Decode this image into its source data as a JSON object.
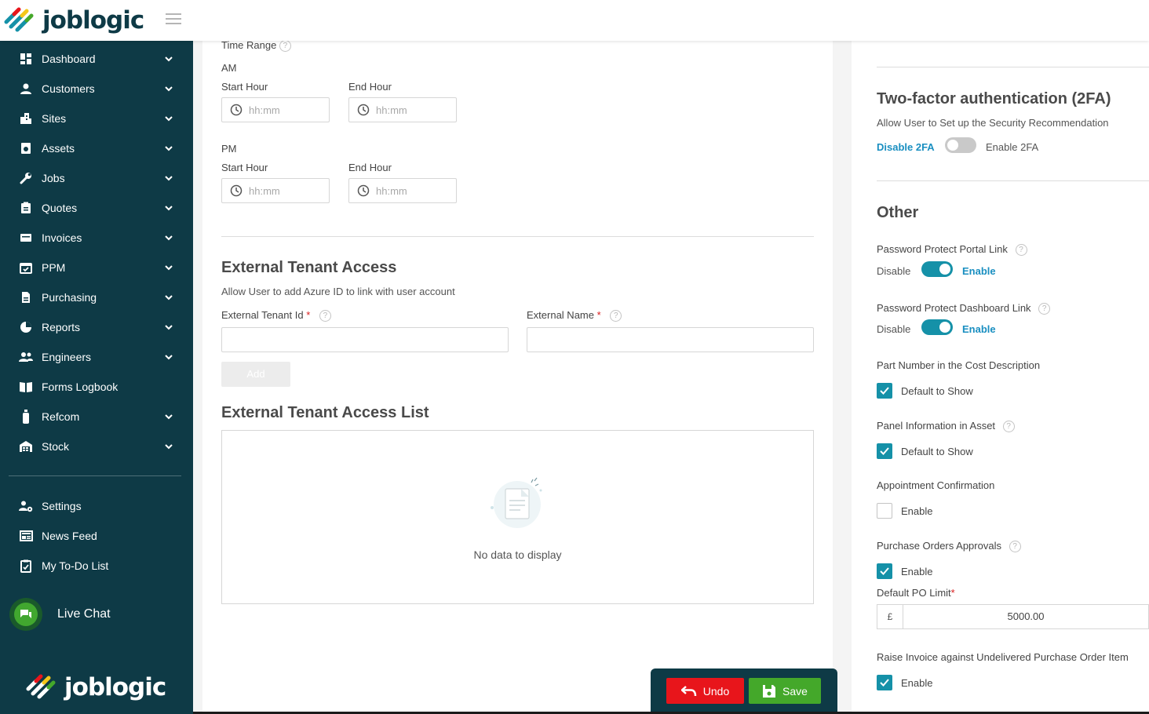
{
  "brand": {
    "name": "joblogic",
    "colors": {
      "dark": "#0e3a46",
      "accent": "#1591a8",
      "link": "#1a8fc1",
      "undo": "#e8151b",
      "save": "#44a82a"
    }
  },
  "sidebar": {
    "items": [
      {
        "label": "Dashboard",
        "icon": "dashboard-icon",
        "has_chevron": true
      },
      {
        "label": "Customers",
        "icon": "person-icon",
        "has_chevron": true
      },
      {
        "label": "Sites",
        "icon": "building-icon",
        "has_chevron": true
      },
      {
        "label": "Assets",
        "icon": "asset-icon",
        "has_chevron": true
      },
      {
        "label": "Jobs",
        "icon": "wrench-icon",
        "has_chevron": true
      },
      {
        "label": "Quotes",
        "icon": "clipboard-icon",
        "has_chevron": true
      },
      {
        "label": "Invoices",
        "icon": "invoice-icon",
        "has_chevron": true
      },
      {
        "label": "PPM",
        "icon": "calendar-icon",
        "has_chevron": true
      },
      {
        "label": "Purchasing",
        "icon": "document-icon",
        "has_chevron": true
      },
      {
        "label": "Reports",
        "icon": "pie-chart-icon",
        "has_chevron": true
      },
      {
        "label": "Engineers",
        "icon": "people-icon",
        "has_chevron": true
      },
      {
        "label": "Forms Logbook",
        "icon": "book-icon",
        "has_chevron": false
      },
      {
        "label": "Refcom",
        "icon": "cylinder-icon",
        "has_chevron": true
      },
      {
        "label": "Stock",
        "icon": "warehouse-icon",
        "has_chevron": true
      }
    ],
    "bottom_items": [
      {
        "label": "Settings",
        "icon": "user-gear-icon"
      },
      {
        "label": "News Feed",
        "icon": "newspaper-icon"
      },
      {
        "label": "My To-Do List",
        "icon": "checklist-icon"
      }
    ],
    "live_chat": "Live Chat"
  },
  "main": {
    "time_range_label": "Time Range",
    "am": {
      "label": "AM",
      "start_label": "Start Hour",
      "end_label": "End Hour",
      "start_placeholder": "hh:mm",
      "end_placeholder": "hh:mm"
    },
    "pm": {
      "label": "PM",
      "start_label": "Start Hour",
      "end_label": "End Hour",
      "start_placeholder": "hh:mm",
      "end_placeholder": "hh:mm"
    },
    "external_tenant": {
      "title": "External Tenant Access",
      "subtitle": "Allow User to add Azure ID to link with user account",
      "tenant_id_label": "External Tenant Id",
      "tenant_id_value": "",
      "name_label": "External Name",
      "name_value": "",
      "required_mark": "*",
      "add_button": "Add"
    },
    "list": {
      "title": "External Tenant Access List",
      "empty_text": "No data to display"
    }
  },
  "right": {
    "twofa": {
      "title": "Two-factor authentication (2FA)",
      "subtitle": "Allow User to Set up the Security Recommendation",
      "disable_label": "Disable 2FA",
      "enable_label": "Enable 2FA",
      "enabled": false
    },
    "other": {
      "title": "Other",
      "portal_link": {
        "label": "Password Protect Portal Link",
        "disable": "Disable",
        "enable": "Enable",
        "enabled": true
      },
      "dashboard_link": {
        "label": "Password Protect Dashboard Link",
        "disable": "Disable",
        "enable": "Enable",
        "enabled": true
      },
      "part_number": {
        "label": "Part Number in the Cost Description",
        "checkbox_label": "Default to Show",
        "checked": true
      },
      "panel_info": {
        "label": "Panel Information in Asset",
        "checkbox_label": "Default to Show",
        "checked": true
      },
      "appointment": {
        "label": "Appointment Confirmation",
        "checkbox_label": "Enable",
        "checked": false
      },
      "po_approvals": {
        "label": "Purchase Orders Approvals",
        "checkbox_label": "Enable",
        "checked": true
      },
      "po_limit": {
        "label": "Default PO Limit",
        "required_mark": "*",
        "currency": "£",
        "value": "5000.00"
      },
      "raise_invoice": {
        "label": "Raise Invoice against Undelivered Purchase Order Item",
        "checkbox_label": "Enable",
        "checked": true
      }
    }
  },
  "actions": {
    "undo": "Undo",
    "save": "Save"
  }
}
